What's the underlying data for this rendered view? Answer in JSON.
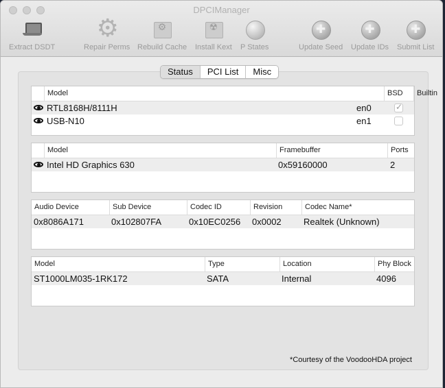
{
  "window": {
    "title": "DPCIManager"
  },
  "toolbar": [
    {
      "label": "Extract DSDT",
      "icon": "laptop-icon"
    },
    {
      "label": "Repair Perms",
      "icon": "gear-icon"
    },
    {
      "label": "Rebuild Cache",
      "icon": "gear-box-icon"
    },
    {
      "label": "Install Kext",
      "icon": "kext-icon"
    },
    {
      "label": "P States",
      "icon": "sphere-icon"
    },
    {
      "label": "Update Seed",
      "icon": "globe-icon"
    },
    {
      "label": "Update IDs",
      "icon": "globe-icon"
    },
    {
      "label": "Submit List",
      "icon": "globe-icon"
    }
  ],
  "tabs": {
    "status": "Status",
    "pci_list": "PCI List",
    "misc": "Misc",
    "selected": "Status"
  },
  "network": {
    "headers": {
      "model": "Model",
      "bsd": "BSD",
      "builtin": "Builtin"
    },
    "rows": [
      {
        "model": "RTL8168H/8111H",
        "bsd": "en0",
        "builtin": true
      },
      {
        "model": "USB-N10",
        "bsd": "en1",
        "builtin": false
      }
    ]
  },
  "graphics": {
    "headers": {
      "model": "Model",
      "framebuffer": "Framebuffer",
      "ports": "Ports"
    },
    "rows": [
      {
        "model": "Intel HD Graphics 630",
        "framebuffer": "0x59160000",
        "ports": "2"
      }
    ]
  },
  "audio": {
    "headers": {
      "audio_device": "Audio Device",
      "sub_device": "Sub Device",
      "codec_id": "Codec ID",
      "revision": "Revision",
      "codec_name": "Codec Name*"
    },
    "rows": [
      {
        "audio_device": "0x8086A171",
        "sub_device": "0x102807FA",
        "codec_id": "0x10EC0256",
        "revision": "0x0002",
        "codec_name": "Realtek (Unknown)"
      }
    ]
  },
  "storage": {
    "headers": {
      "model": "Model",
      "type": "Type",
      "location": "Location",
      "phy_block": "Phy Block"
    },
    "rows": [
      {
        "model": "ST1000LM035-1RK172",
        "type": "SATA",
        "location": "Internal",
        "phy_block": "4096"
      }
    ]
  },
  "footer": {
    "credit": "*Courtesy of the VoodooHDA project"
  }
}
